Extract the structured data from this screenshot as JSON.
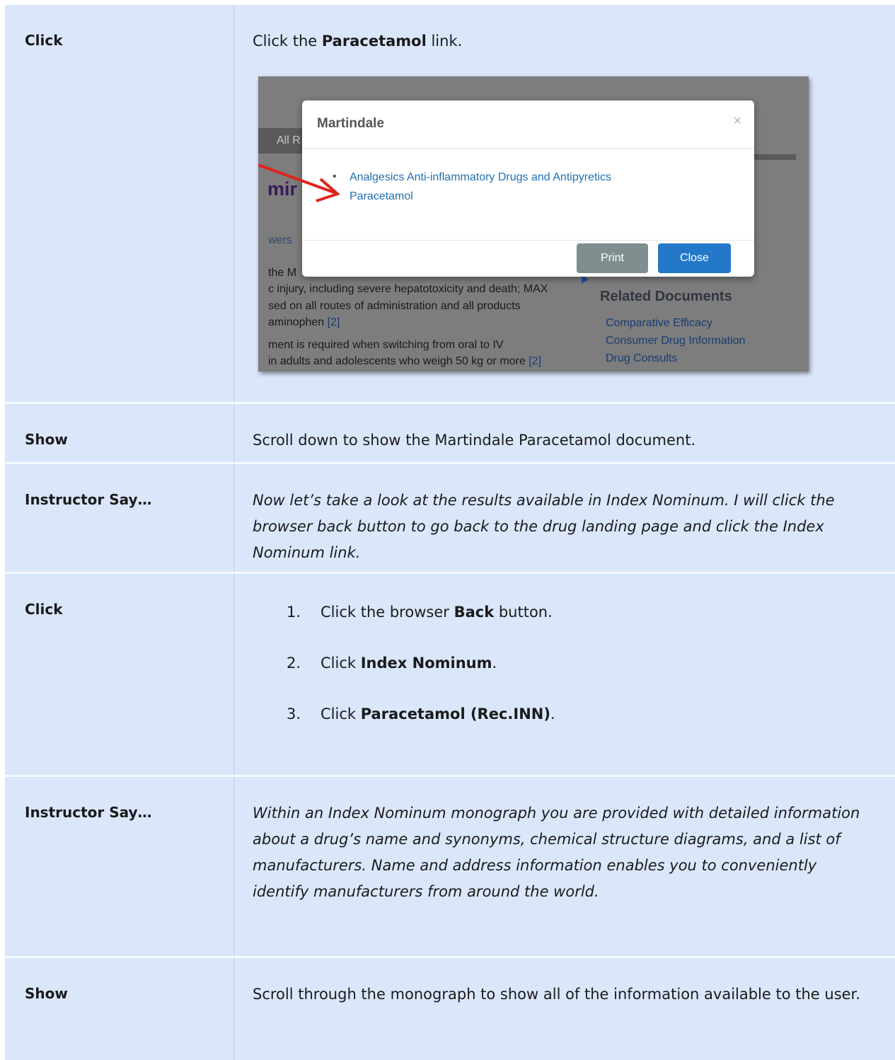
{
  "rows": [
    {
      "label": "Click",
      "text_before": "Click the ",
      "text_bold": "Paracetamol",
      "text_after": " link."
    },
    {
      "label": "Show",
      "text": "Scroll down to show the Martindale Paracetamol document."
    },
    {
      "label": "Instructor Say…",
      "text": "Now let’s take a look at the results available in Index Nominum. I will click the browser back button to go back to the drug landing page and click the Index Nominum link."
    },
    {
      "label": "Click",
      "steps": [
        {
          "num": "1.",
          "before": "Click the browser ",
          "bold": "Back",
          "after": " button."
        },
        {
          "num": "2.",
          "before": "Click ",
          "bold": "Index Nominum",
          "after": "."
        },
        {
          "num": "3.",
          "before": "Click ",
          "bold": "Paracetamol (Rec.INN)",
          "after": "."
        }
      ]
    },
    {
      "label": "Instructor Say…",
      "text": "Within an Index Nominum monograph you are provided with detailed information about a drug’s name and synonyms, chemical structure diagrams, and a list of manufacturers. Name and address information enables you to conveniently identify manufacturers from around the world."
    },
    {
      "label": "Show",
      "text": "Scroll through the monograph to show all of the information available to the user."
    }
  ],
  "screenshot": {
    "modal_title": "Martindale",
    "close_glyph": "×",
    "items": [
      "Analgesics Anti-inflammatory Drugs and Antipyretics",
      "Paracetamol"
    ],
    "print_label": "Print",
    "close_label": "Close",
    "bg_tab": "All R",
    "bg_heading": "mir",
    "bg_lines": [
      "wers",
      "the M",
      "c injury, including severe hepatotoxicity and death; MAX",
      "sed on all routes of administration and all products",
      "aminophen",
      "ment is required when switching from oral to IV",
      "in adults and adolescents who weigh 50 kg or more"
    ],
    "bg_refs": [
      "[2]",
      "[2]"
    ],
    "related_heading": "Related Documents",
    "related_links": [
      "Comparative Efficacy",
      "Consumer Drug Information",
      "Drug Consults"
    ],
    "arrow_color": "#e0231d"
  }
}
